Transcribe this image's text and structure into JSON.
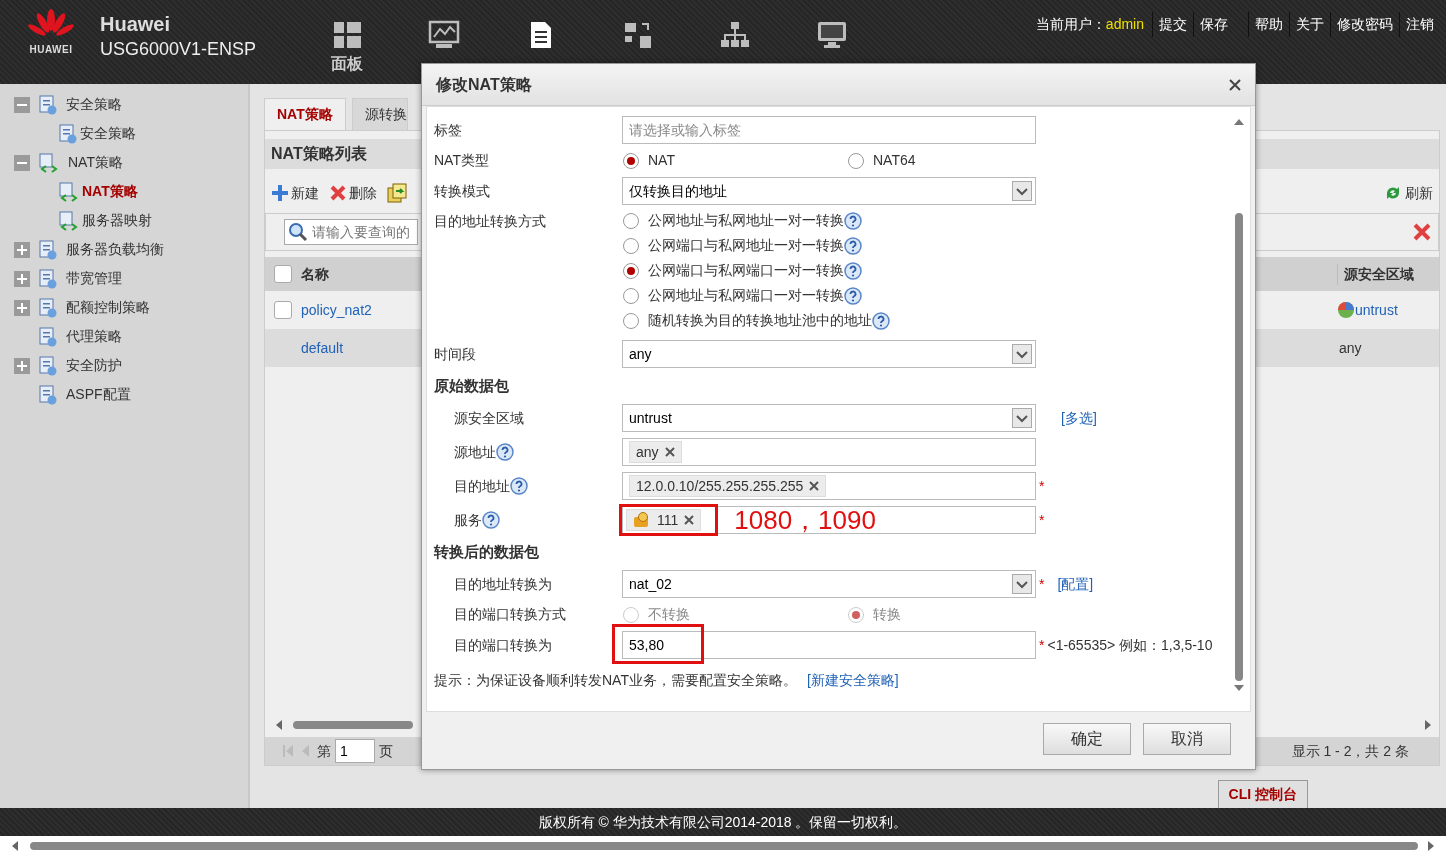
{
  "header": {
    "logo_text": "HUAWEI",
    "brand": "Huawei",
    "model": "USG6000V1-ENSP",
    "nav": [
      {
        "label": "面板",
        "selected": false
      },
      {
        "selected": false
      },
      {
        "selected": true
      },
      {
        "selected": false
      },
      {
        "selected": false
      },
      {
        "selected": false
      }
    ],
    "user_label": "当前用户：",
    "user": "admin",
    "links": [
      "提交",
      "保存",
      "帮助",
      "关于",
      "修改密码",
      "注销"
    ]
  },
  "sidebar": {
    "items": [
      {
        "label": "安全策略",
        "expanded": true,
        "children": [
          {
            "label": "安全策略",
            "selected": false
          }
        ]
      },
      {
        "label": "NAT策略",
        "expanded": true,
        "children": [
          {
            "label": "NAT策略",
            "selected": true
          },
          {
            "label": "服务器映射",
            "selected": false
          }
        ]
      },
      {
        "label": "服务器负载均衡",
        "expanded": false
      },
      {
        "label": "带宽管理",
        "expanded": false
      },
      {
        "label": "配额控制策略",
        "expanded": false
      },
      {
        "label": "代理策略"
      },
      {
        "label": "安全防护",
        "expanded": false
      },
      {
        "label": "ASPF配置"
      }
    ]
  },
  "content": {
    "tabs": [
      {
        "label": "NAT策略",
        "selected": true
      },
      {
        "label": "源转换",
        "selected": false
      }
    ],
    "list_title": "NAT策略列表",
    "toolbar": [
      {
        "kind": "add",
        "label": "新建"
      },
      {
        "kind": "delete",
        "label": "删除"
      },
      {
        "kind": "copy"
      }
    ],
    "refresh": "刷新",
    "search_placeholder": "请输入要查询的",
    "table": {
      "header_checked": false,
      "columns": [
        "名称",
        "源安全区域"
      ],
      "rows": [
        {
          "kind": "policy",
          "checked": false,
          "name": "policy_nat2",
          "zone": "untrust"
        },
        {
          "kind": "default",
          "name": "default",
          "zone": "any"
        }
      ]
    },
    "pagination": {
      "page_label": "第",
      "page": "1",
      "page_suffix": "页",
      "summary": "显示 1 - 2，共 2 条"
    },
    "cli_button": "CLI 控制台"
  },
  "footer": "版权所有 © 华为技术有限公司2014-2018 。保留一切权利。",
  "dialog": {
    "title": "修改NAT策略",
    "rows": [
      {
        "kind": "input",
        "label": "标签",
        "placeholder": "请选择或输入标签"
      },
      {
        "kind": "radio",
        "label": "NAT类型",
        "disabled": false,
        "options": [
          {
            "label": "NAT",
            "selected": true
          },
          {
            "label": "NAT64",
            "selected": false
          }
        ]
      },
      {
        "kind": "select",
        "label": "转换模式",
        "value": "仅转换目的地址"
      },
      {
        "kind": "radio-list",
        "label": "目的地址转换方式",
        "options": [
          {
            "label": "公网地址与私网地址一对一转换",
            "selected": false
          },
          {
            "label": "公网端口与私网地址一对一转换",
            "selected": false
          },
          {
            "label": "公网端口与私网端口一对一转换",
            "selected": true
          },
          {
            "label": "公网地址与私网端口一对一转换",
            "selected": false
          },
          {
            "label": "随机转换为目的转换地址池中的地址",
            "selected": false
          }
        ]
      },
      {
        "kind": "select",
        "label": "时间段",
        "value": "any"
      },
      {
        "kind": "section",
        "label": "原始数据包",
        "children": [
          {
            "kind": "select",
            "label": "源安全区域",
            "value": "untrust",
            "link": "[多选]"
          },
          {
            "kind": "tags",
            "label": "源地址",
            "help": true,
            "tags": [
              {
                "kind": "plain",
                "text": "any"
              }
            ]
          },
          {
            "kind": "tags",
            "label": "目的地址",
            "help": true,
            "required_mark": "*",
            "tags": [
              {
                "kind": "plain",
                "text": "12.0.0.10/255.255.255.255"
              }
            ]
          },
          {
            "kind": "tags",
            "label": "服务",
            "help": true,
            "required_mark": "*",
            "highlight": true,
            "annotation": "1080，1090",
            "tags": [
              {
                "kind": "service",
                "text": "111"
              }
            ]
          }
        ]
      },
      {
        "kind": "section",
        "label": "转换后的数据包",
        "children": [
          {
            "kind": "select",
            "label": "目的地址转换为",
            "value": "nat_02",
            "required_mark": "*",
            "link": "[配置]"
          },
          {
            "kind": "radio",
            "label": "目的端口转换方式",
            "disabled": true,
            "options": [
              {
                "label": "不转换",
                "selected": false
              },
              {
                "label": "转换",
                "selected": true
              }
            ]
          },
          {
            "kind": "input",
            "label": "目的端口转换为",
            "value": "53,80",
            "required_mark": "*",
            "highlight": true,
            "hint": "<1-65535> 例如：1,3,5-10"
          }
        ]
      }
    ],
    "note": {
      "text": "提示：为保证设备顺利转发NAT业务，需要配置安全策略。",
      "link": "[新建安全策略]"
    },
    "buttons": [
      "确定",
      "取消"
    ]
  }
}
